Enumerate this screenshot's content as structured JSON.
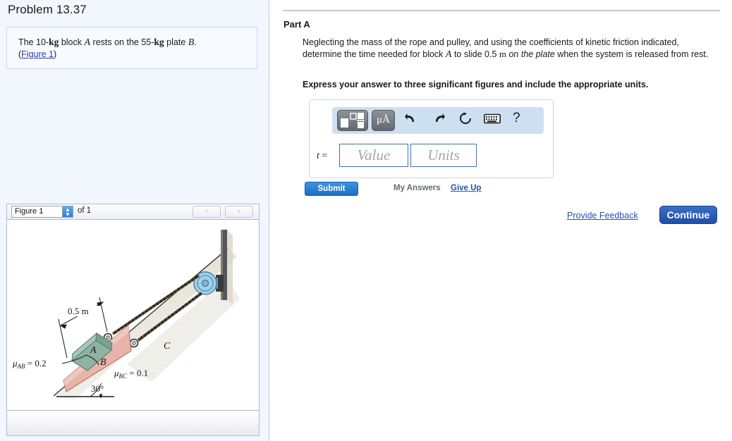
{
  "problem": {
    "title": "Problem 13.37",
    "statement_pre": "The 10-",
    "statement_kg1": "kg",
    "statement_mid": " block ",
    "statement_blockA": "A",
    "statement_mid2": " rests on the 55-",
    "statement_kg2": "kg",
    "statement_mid3": " plate ",
    "statement_blockB": "B",
    "statement_end": ".",
    "figure_link": "Figure 1",
    "paren_open": "(",
    "paren_close": ")"
  },
  "figure_panel": {
    "select_value": "Figure 1",
    "select_options": [
      "Figure 1"
    ],
    "of_label": "of 1",
    "prev_label": "‹",
    "next_label": "›",
    "spinner_up": "▲",
    "spinner_down": "▼"
  },
  "figure": {
    "dimension_label": "0.5 m",
    "block_a_label": "A",
    "plate_b_label": "B",
    "incline_label": "C",
    "mu_ab_label": "μ",
    "mu_ab_sub": "AB",
    "mu_ab_value": " = 0.2",
    "mu_bc_label": "μ",
    "mu_bc_sub": "BC",
    "mu_bc_value": " = 0.1",
    "angle_label": "30°",
    "colors": {
      "block_a": "#8fb3a3",
      "block_a_edge": "#6d9383",
      "plate_b": "#e8b3a8",
      "plate_b_edge": "#cf9184",
      "pulley": "#9fd1e8",
      "pulley_dark": "#5f9fc4",
      "wall": "#4a4a4a",
      "rope": "#3a2e22",
      "shadow": "#ded9cc"
    }
  },
  "part_a": {
    "heading": "Part A",
    "body_1": "Neglecting the mass of the rope and pulley, and using the coefficients of kinetic friction indicated,",
    "body_2a": "determine the time needed for block ",
    "body_2b": "A",
    "body_2c": " to slide 0.5 ",
    "body_2d": "m",
    "body_2e": " ",
    "body_2f": "on the plate",
    "body_2g": " when the system is released from",
    "body_3": "rest.",
    "express": "Express your answer to three significant figures and include the appropriate units."
  },
  "answer": {
    "t_label_var": "t",
    "t_label_eq": " =",
    "value_placeholder": "Value",
    "units_placeholder": "Units",
    "value_current": "",
    "units_current": "",
    "toolbar": {
      "template_icon": "math-template-icon",
      "units_button_label": "μÅ",
      "undo_icon": "⬌",
      "redo_icon": "⬌",
      "reset_icon": "↺",
      "keyboard_icon": "⌨",
      "help_icon": "?"
    }
  },
  "actions": {
    "submit": "Submit",
    "my_answers": "My Answers",
    "give_up": "Give Up",
    "provide_feedback": "Provide Feedback",
    "continue": "Continue"
  }
}
